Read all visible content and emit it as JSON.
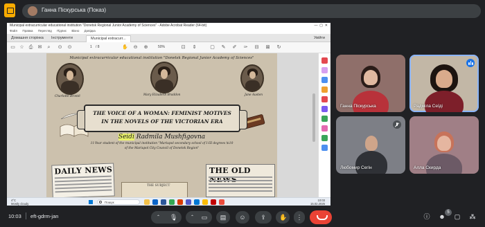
{
  "presenter": {
    "label": "Ганна Піскурська (Показ)"
  },
  "acrobat": {
    "window_title": "Municipal extracurricular educational institution \"Donetsk Regional Junior Academy of Sciences\" - Adobe Acrobat Reader (64-bit)",
    "menu": [
      "Файл",
      "Правка",
      "Перегляд",
      "Підпис",
      "Вікно",
      "Довідка"
    ],
    "tabs": [
      "Домашня сторінка",
      "Інструменти",
      "Municipal extracurr..."
    ],
    "signin": "Увійти",
    "page_current": "1",
    "page_total": "/ 8",
    "zoom": "50%"
  },
  "slide": {
    "org_line": "Municipal extracurricular educational institution \"Donetsk Regional Junior Academy of Sciences\"",
    "captions": {
      "bronte": "Charlotte Brontë",
      "braddon": "Mary Elizabeth Braddon",
      "austen": "Jane Austen"
    },
    "title_line1": "The voice of a woman: feminist motives",
    "title_line2": "in the novels of  the  Victorian era",
    "author_first": "Seidi",
    "author_rest": " Radmila Mushfigovna",
    "student_line1": "11-Year student of the municipal institution \"Mariupol secondary school of I-III degrees №10",
    "student_line2": "of the Mariupol City Council of Donetsk Region\"",
    "news_left": "DAILY NEWS",
    "news_right": "THE OLD NEWS",
    "news_mid": "THE SUBJECT"
  },
  "taskbar": {
    "weather_temp": "4°C",
    "weather_desc": "Mostly cloudy",
    "search": "Пошук",
    "clock_time": "10:03",
    "clock_date": "15.02.2025"
  },
  "participants": [
    {
      "name": "Ганна Піскурська"
    },
    {
      "name": "Радміла Сеїді"
    },
    {
      "name": "Любомир Сегін"
    },
    {
      "name": "Алла Скирда"
    }
  ],
  "bottom_bar": {
    "time": "10:03",
    "meeting_code": "eft-gdrm-jan",
    "people_count": "5"
  },
  "colors": {
    "meet_bg": "#202124",
    "end_call": "#ea4335",
    "speaking": "#1a73e8",
    "logo": "#f9ab00"
  }
}
